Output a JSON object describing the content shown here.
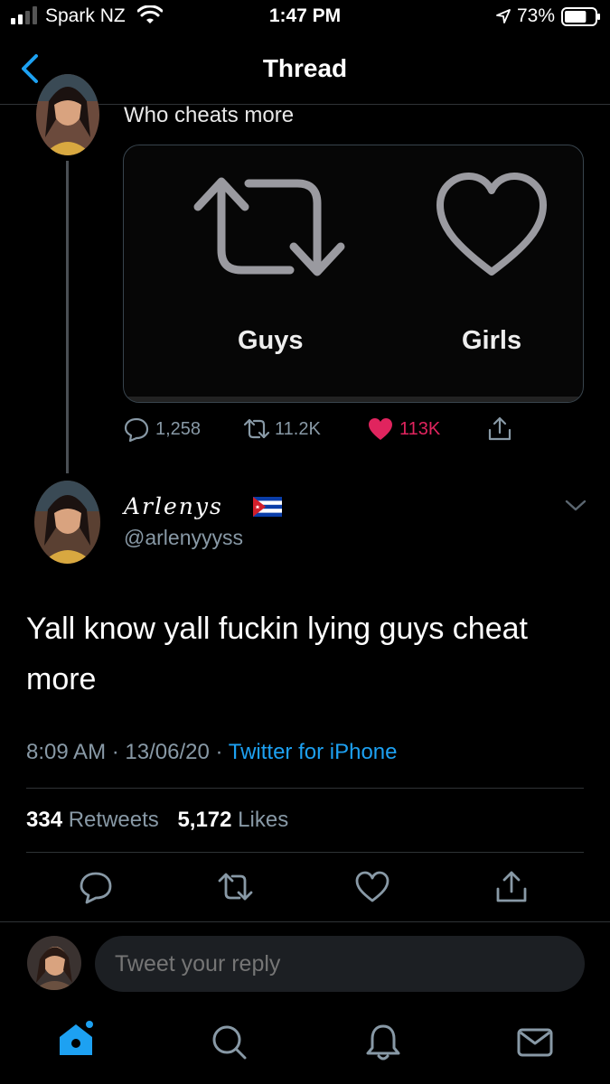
{
  "status_bar": {
    "carrier": "Spark NZ",
    "time": "1:47 PM",
    "battery": "73%",
    "battery_level": 0.73
  },
  "nav": {
    "title": "Thread"
  },
  "parent_tweet": {
    "text": "Who cheats more",
    "media_labels": {
      "left": "Guys",
      "right": "Girls"
    },
    "reply_count": "1,258",
    "retweet_count": "11.2K",
    "like_count": "113K"
  },
  "tweet": {
    "display_name": "Arlenys",
    "handle": "@arlenyyyss",
    "text": "Yall know yall fuckin lying guys cheat more",
    "time": "8:09 AM",
    "date": "13/06/20",
    "source": "Twitter for iPhone",
    "retweets": "334",
    "retweets_label": "Retweets",
    "likes": "5,172",
    "likes_label": "Likes"
  },
  "composer": {
    "placeholder": "Tweet your reply"
  },
  "colors": {
    "background": "#000000",
    "accent": "#1da1f2",
    "like": "#e0245e",
    "muted": "#8899a6"
  }
}
